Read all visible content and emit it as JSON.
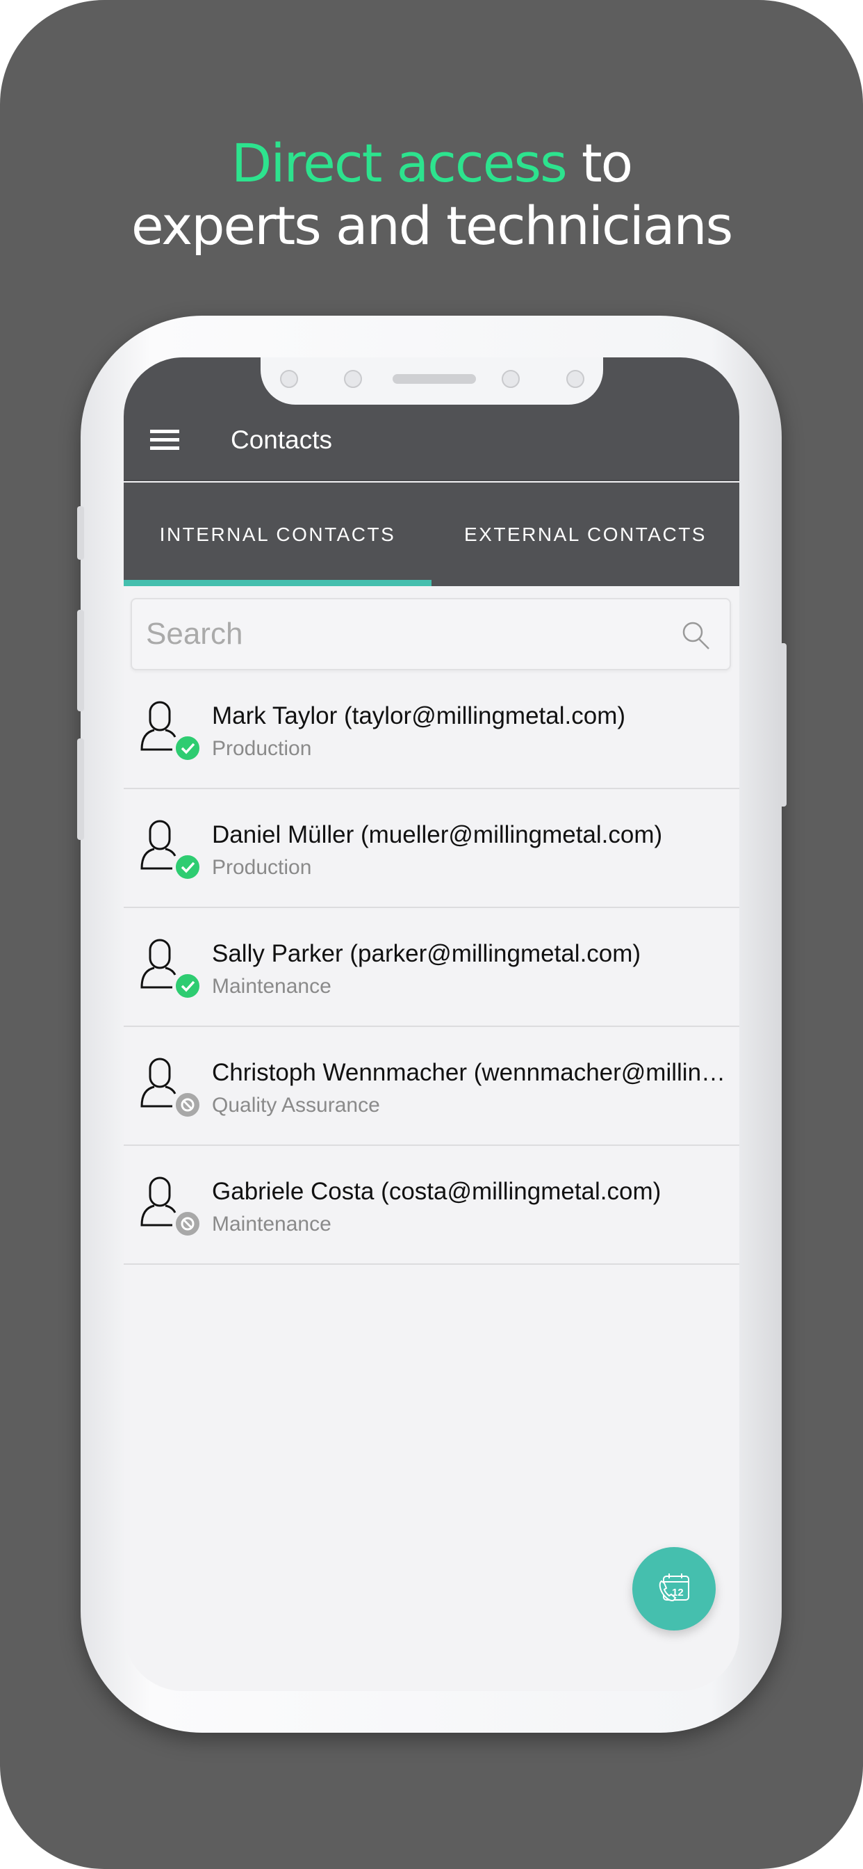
{
  "headline": {
    "accent": "Direct access",
    "rest_line1": " to",
    "line2": "experts and technicians"
  },
  "colors": {
    "accent": "#2de38e",
    "appbar": "#515255",
    "tab_indicator": "#45bfae",
    "online": "#2ecc71",
    "offline": "#a8a8a8",
    "fab": "#45bfae"
  },
  "appbar": {
    "menu_icon": "hamburger-icon",
    "title": "Contacts"
  },
  "tabs": [
    {
      "label": "INTERNAL CONTACTS",
      "active": true
    },
    {
      "label": "EXTERNAL CONTACTS",
      "active": false
    }
  ],
  "search": {
    "placeholder": "Search",
    "value": "",
    "icon": "search-icon"
  },
  "contacts": [
    {
      "name": "Mark Taylor (taylor@millingmetal.com)",
      "department": "Production",
      "status": "available"
    },
    {
      "name": "Daniel Müller (mueller@millingmetal.com)",
      "department": "Production",
      "status": "available"
    },
    {
      "name": "Sally Parker (parker@millingmetal.com)",
      "department": "Maintenance",
      "status": "available"
    },
    {
      "name": "Christoph Wennmacher (wennmacher@millingmetal.com)",
      "department": "Quality Assurance",
      "status": "unavailable"
    },
    {
      "name": "Gabriele Costa (costa@millingmetal.com)",
      "department": "Maintenance",
      "status": "unavailable"
    }
  ],
  "fab": {
    "icon": "calendar-phone-icon",
    "icon_text": "12"
  }
}
